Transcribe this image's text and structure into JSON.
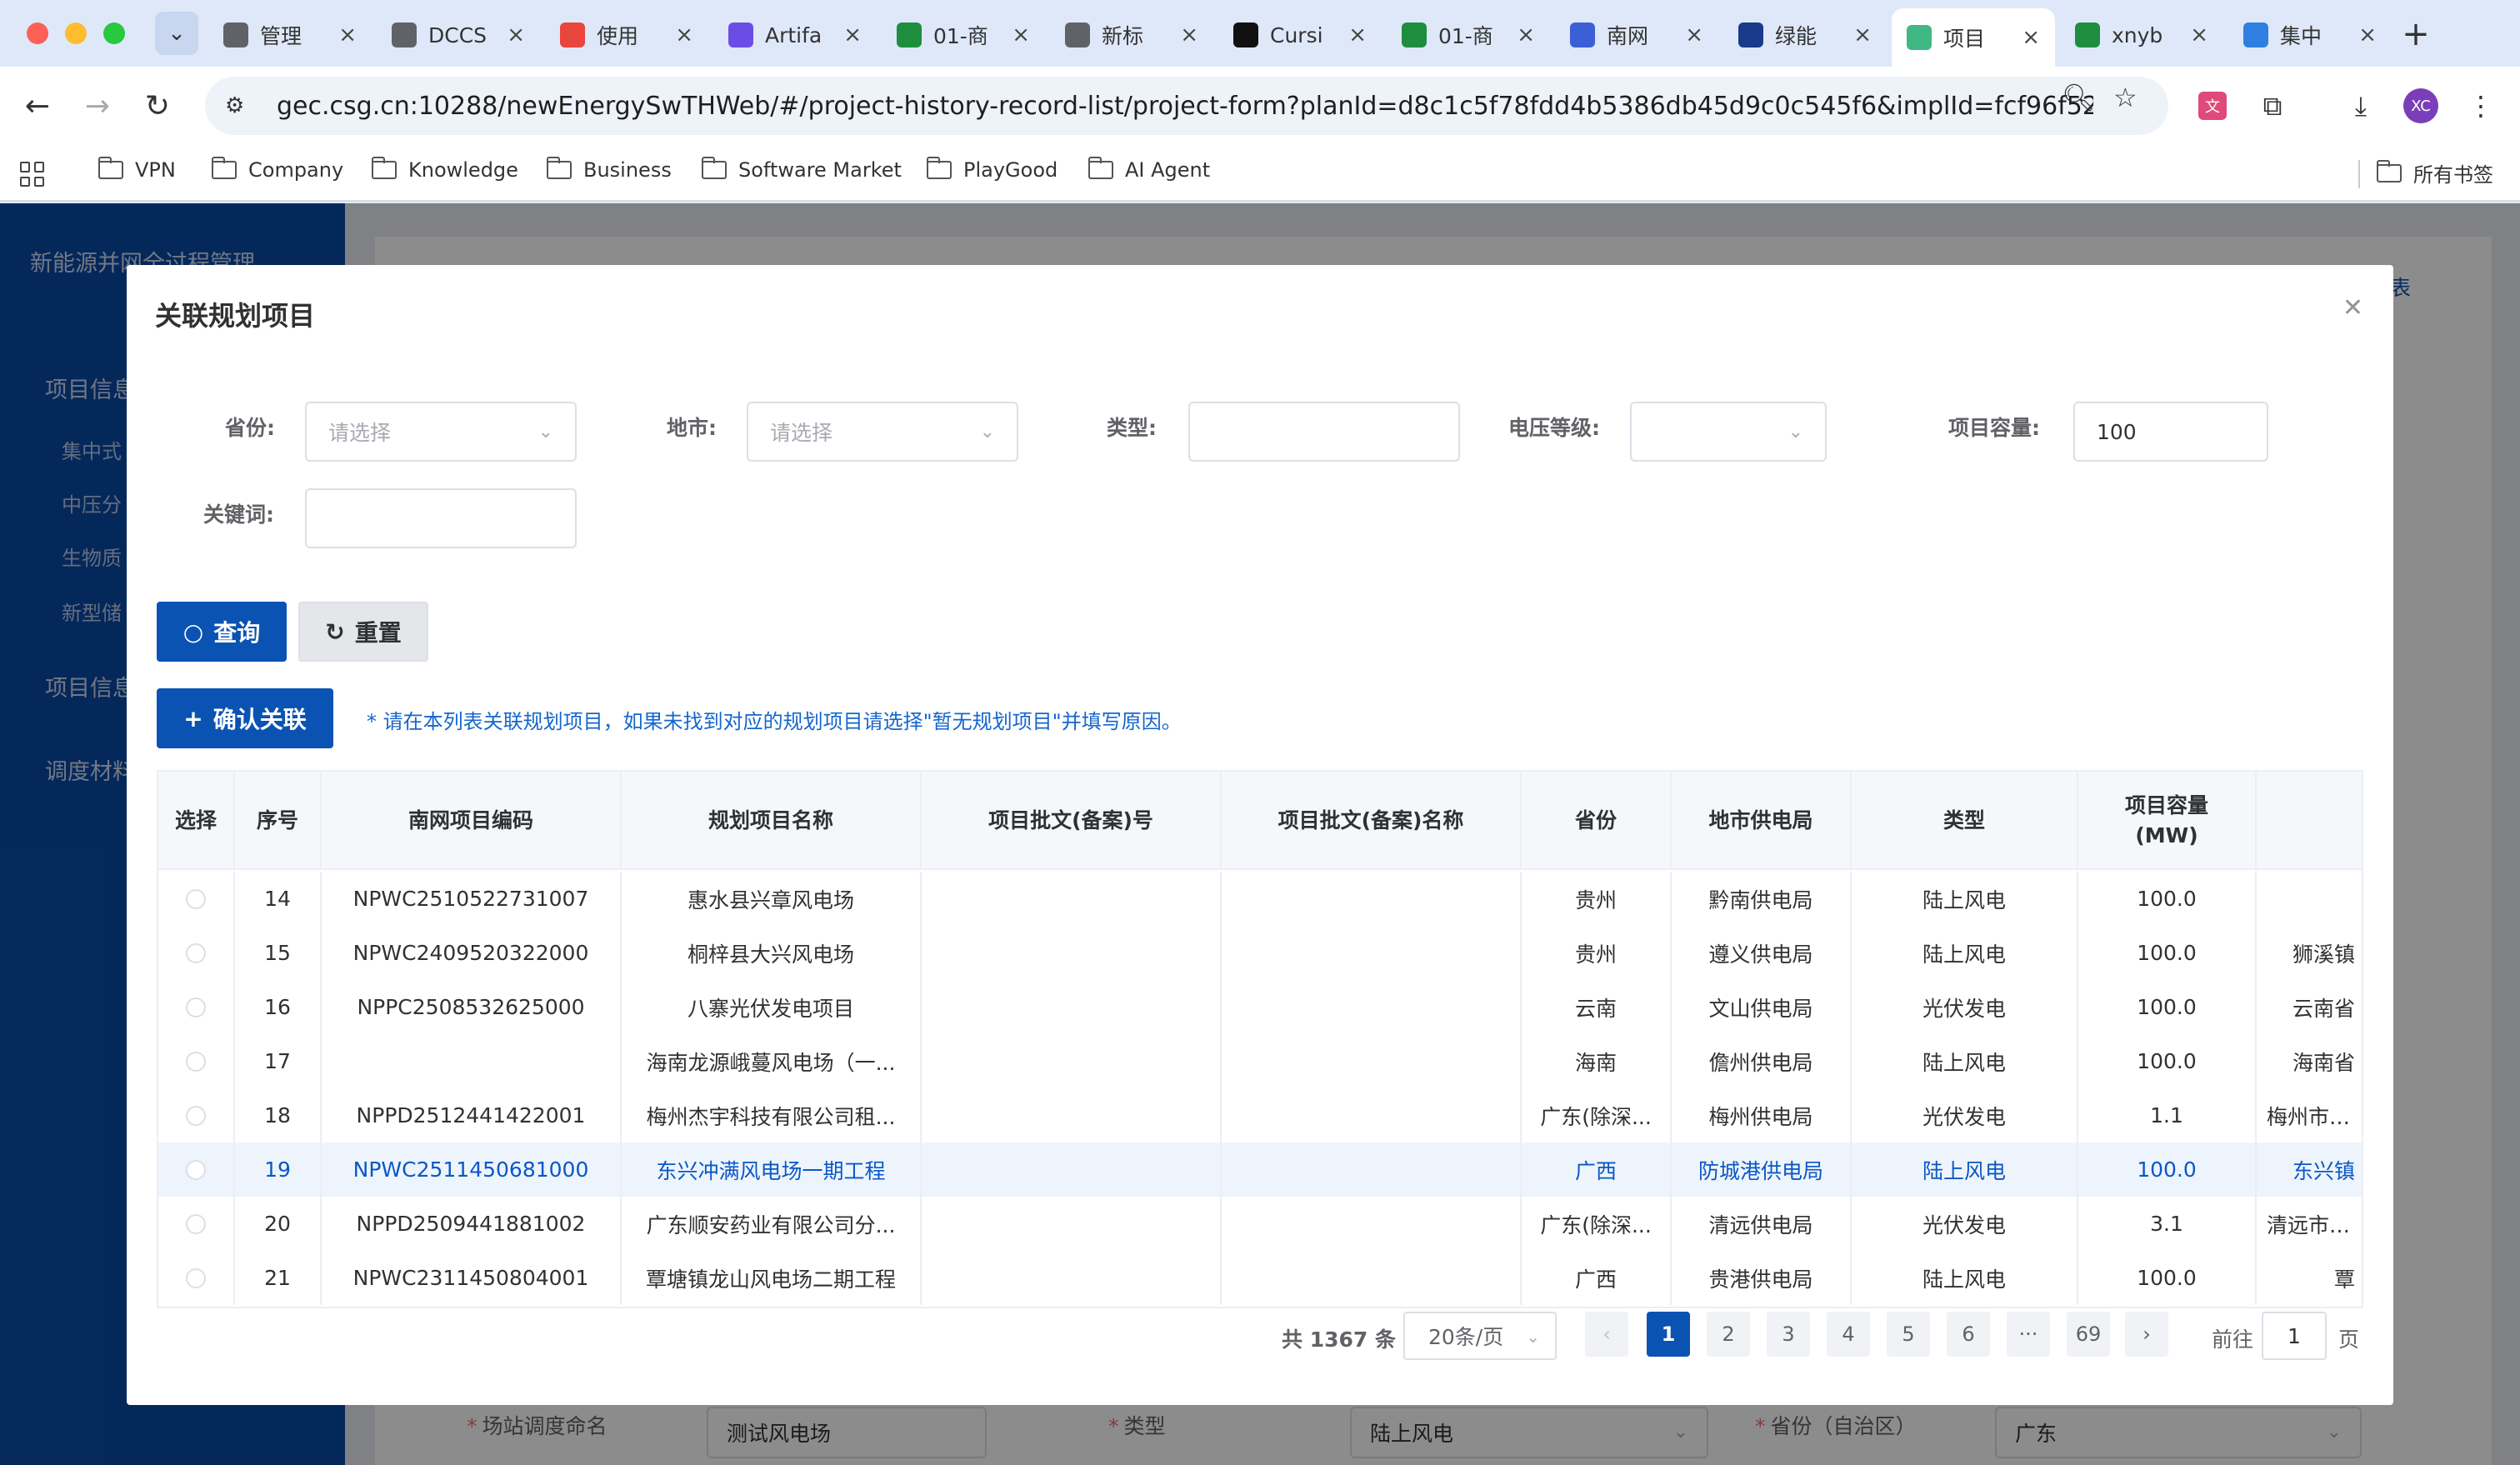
{
  "browser": {
    "tabs": [
      {
        "label": "管理",
        "favicon_color": "#5f6368",
        "favicon": "globe-icon"
      },
      {
        "label": "DCCS",
        "favicon_color": "#5f6368",
        "favicon": "globe-icon"
      },
      {
        "label": "使用",
        "favicon_color": "#e8453c",
        "favicon": "chrome-icon"
      },
      {
        "label": "Artifa",
        "favicon_color": "#6b4de6",
        "favicon": "c-logo-icon"
      },
      {
        "label": "01-商",
        "favicon_color": "#1e8e3e",
        "favicon": "sheet-icon"
      },
      {
        "label": "新标",
        "favicon_color": "#5f6368",
        "favicon": "globe-icon"
      },
      {
        "label": "Cursi",
        "favicon_color": "#111111",
        "favicon": "cursor-icon"
      },
      {
        "label": "01-商",
        "favicon_color": "#1e8e3e",
        "favicon": "sheet-icon"
      },
      {
        "label": "南网",
        "favicon_color": "#3c5fd6",
        "favicon": "paw-icon"
      },
      {
        "label": "绿能",
        "favicon_color": "#1a3a8a",
        "favicon": "lines-icon"
      },
      {
        "label": "项目",
        "favicon_color": "#41b883",
        "favicon": "vue-icon"
      },
      {
        "label": "xnyb",
        "favicon_color": "#1e8e3e",
        "favicon": "sheet-icon"
      },
      {
        "label": "集中",
        "favicon_color": "#2f7fe0",
        "favicon": "bird-icon"
      }
    ],
    "active_tab_index": 10,
    "url": "gec.csg.cn:10288/newEnergySwTHWeb/#/project-history-record-list/project-form?planId=d8c1c5f78fdd4b5386db45d9c0c545f6&implId=fcf96f52257740b3a...",
    "avatar_initials": "XC",
    "bookmarks": [
      "VPN",
      "Company",
      "Knowledge",
      "Business",
      "Software Market",
      "PlayGood",
      "AI Agent"
    ],
    "all_bookmarks": "所有书签"
  },
  "app": {
    "title": "新能源并网全过程管理",
    "sidebar": {
      "group1": "项目信息",
      "sub_items": [
        "集中式",
        "中压分",
        "生物质",
        "新型储"
      ],
      "group2": "项目信息",
      "group3": "调度材料"
    },
    "bg_form": {
      "fields": [
        {
          "label": "场站调度命名",
          "value": "测试风电场"
        },
        {
          "label": "类型",
          "value": "陆上风电"
        },
        {
          "label": "省份（自治区）",
          "value": "广东"
        }
      ],
      "corner_text": "表"
    }
  },
  "modal": {
    "title": "关联规划项目",
    "filters": {
      "province": {
        "label": "省份:",
        "placeholder": "请选择"
      },
      "city": {
        "label": "地市:",
        "placeholder": "请选择"
      },
      "type": {
        "label": "类型:",
        "value": ""
      },
      "voltage": {
        "label": "电压等级:",
        "value": ""
      },
      "capacity": {
        "label": "项目容量:",
        "value": "100"
      },
      "keyword": {
        "label": "关键词:",
        "value": ""
      }
    },
    "buttons": {
      "search": "查询",
      "reset": "重置",
      "confirm": "确认关联"
    },
    "hint": "* 请在本列表关联规划项目，如果未找到对应的规划项目请选择\"暂无规划项目\"并填写原因。",
    "table": {
      "headers": [
        "选择",
        "序号",
        "南网项目编码",
        "规划项目名称",
        "项目批文(备案)号",
        "项目批文(备案)名称",
        "省份",
        "地市供电局",
        "类型",
        "项目容量(MW)",
        ""
      ],
      "rows": [
        {
          "no": "14",
          "code": "NPWC2510522731007",
          "name": "惠水县兴章风电场",
          "approval_no": "",
          "approval_name": "",
          "province": "贵州",
          "bureau": "黔南供电局",
          "type": "陆上风电",
          "capacity": "100.0",
          "extra": ""
        },
        {
          "no": "15",
          "code": "NPWC2409520322000",
          "name": "桐梓县大兴风电场",
          "approval_no": "",
          "approval_name": "",
          "province": "贵州",
          "bureau": "遵义供电局",
          "type": "陆上风电",
          "capacity": "100.0",
          "extra": "狮溪镇"
        },
        {
          "no": "16",
          "code": "NPPC2508532625000",
          "name": "八寨光伏发电项目",
          "approval_no": "",
          "approval_name": "",
          "province": "云南",
          "bureau": "文山供电局",
          "type": "光伏发电",
          "capacity": "100.0",
          "extra": "云南省"
        },
        {
          "no": "17",
          "code": "",
          "name": "海南龙源峨蔓风电场（一...",
          "approval_no": "",
          "approval_name": "",
          "province": "海南",
          "bureau": "儋州供电局",
          "type": "陆上风电",
          "capacity": "100.0",
          "extra": "海南省"
        },
        {
          "no": "18",
          "code": "NPPD2512441422001",
          "name": "梅州杰宇科技有限公司租...",
          "approval_no": "",
          "approval_name": "",
          "province": "广东(除深...",
          "bureau": "梅州供电局",
          "type": "光伏发电",
          "capacity": "1.1",
          "extra": "梅州市大埔"
        },
        {
          "no": "19",
          "code": "NPWC2511450681000",
          "name": "东兴冲满风电场一期工程",
          "approval_no": "",
          "approval_name": "",
          "province": "广西",
          "bureau": "防城港供电局",
          "type": "陆上风电",
          "capacity": "100.0",
          "extra": "东兴镇"
        },
        {
          "no": "20",
          "code": "NPPD2509441881002",
          "name": "广东顺安药业有限公司分...",
          "approval_no": "",
          "approval_name": "",
          "province": "广东(除深...",
          "bureau": "清远供电局",
          "type": "光伏发电",
          "capacity": "3.1",
          "extra": "清远市英德"
        },
        {
          "no": "21",
          "code": "NPWC2311450804001",
          "name": "覃塘镇龙山风电场二期工程",
          "approval_no": "",
          "approval_name": "",
          "province": "广西",
          "bureau": "贵港供电局",
          "type": "陆上风电",
          "capacity": "100.0",
          "extra": "覃"
        }
      ],
      "highlighted_row_no": "19"
    },
    "pagination": {
      "total_text": "共 1367 条",
      "page_size": "20条/页",
      "pages": [
        "1",
        "2",
        "3",
        "4",
        "5",
        "6",
        "···",
        "69"
      ],
      "current_page": "1",
      "goto_label": "前往",
      "goto_value": "1",
      "goto_suffix": "页"
    }
  }
}
